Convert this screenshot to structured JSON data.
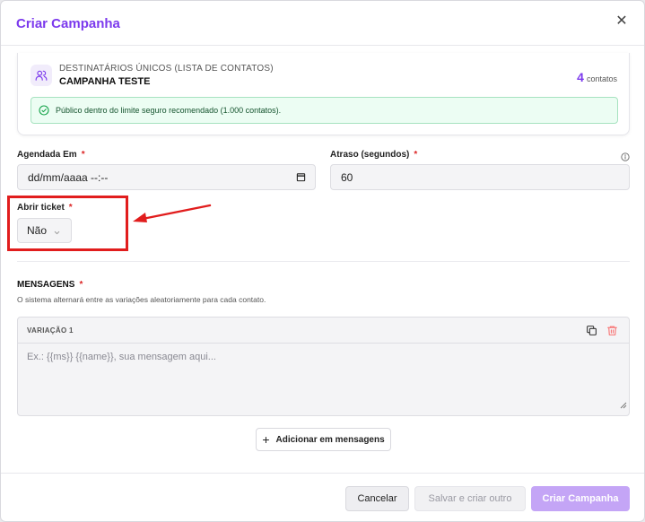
{
  "modal": {
    "title": "Criar Campanha",
    "close_glyph": "✕"
  },
  "audience": {
    "label": "DESTINATÁRIOS ÚNICOS (LISTA DE CONTATOS)",
    "name": "CAMPANHA TESTE",
    "count": "4",
    "count_unit": "contatos",
    "icon": "users-icon",
    "safe_message": "Público dentro do limite seguro recomendado (1.000 contatos)."
  },
  "schedule": {
    "label": "Agendada Em",
    "required_mark": "*",
    "value": "dd/mm/aaaa --:--"
  },
  "delay": {
    "label": "Atraso (segundos)",
    "required_mark": "*",
    "value": "60"
  },
  "ticket": {
    "label": "Abrir ticket",
    "required_mark": "*",
    "selected": "Não"
  },
  "messages": {
    "title": "MENSAGENS",
    "required_mark": "*",
    "help": "O sistema alternará entre as variações aleatoriamente para cada contato.",
    "variations": [
      {
        "label": "VARIAÇÃO 1",
        "placeholder": "Ex.: {{ms}} {{name}}, sua mensagem aqui..."
      }
    ],
    "add_label": "Adicionar em mensagens"
  },
  "footer": {
    "cancel": "Cancelar",
    "save_other": "Salvar e criar outro",
    "create": "Criar Campanha"
  },
  "colors": {
    "accent": "#7c3aed",
    "accent_disabled": "#c4a5f6",
    "required": "#dc2626",
    "success_bg": "#ecfdf3",
    "annotation": "#e11d1d"
  }
}
